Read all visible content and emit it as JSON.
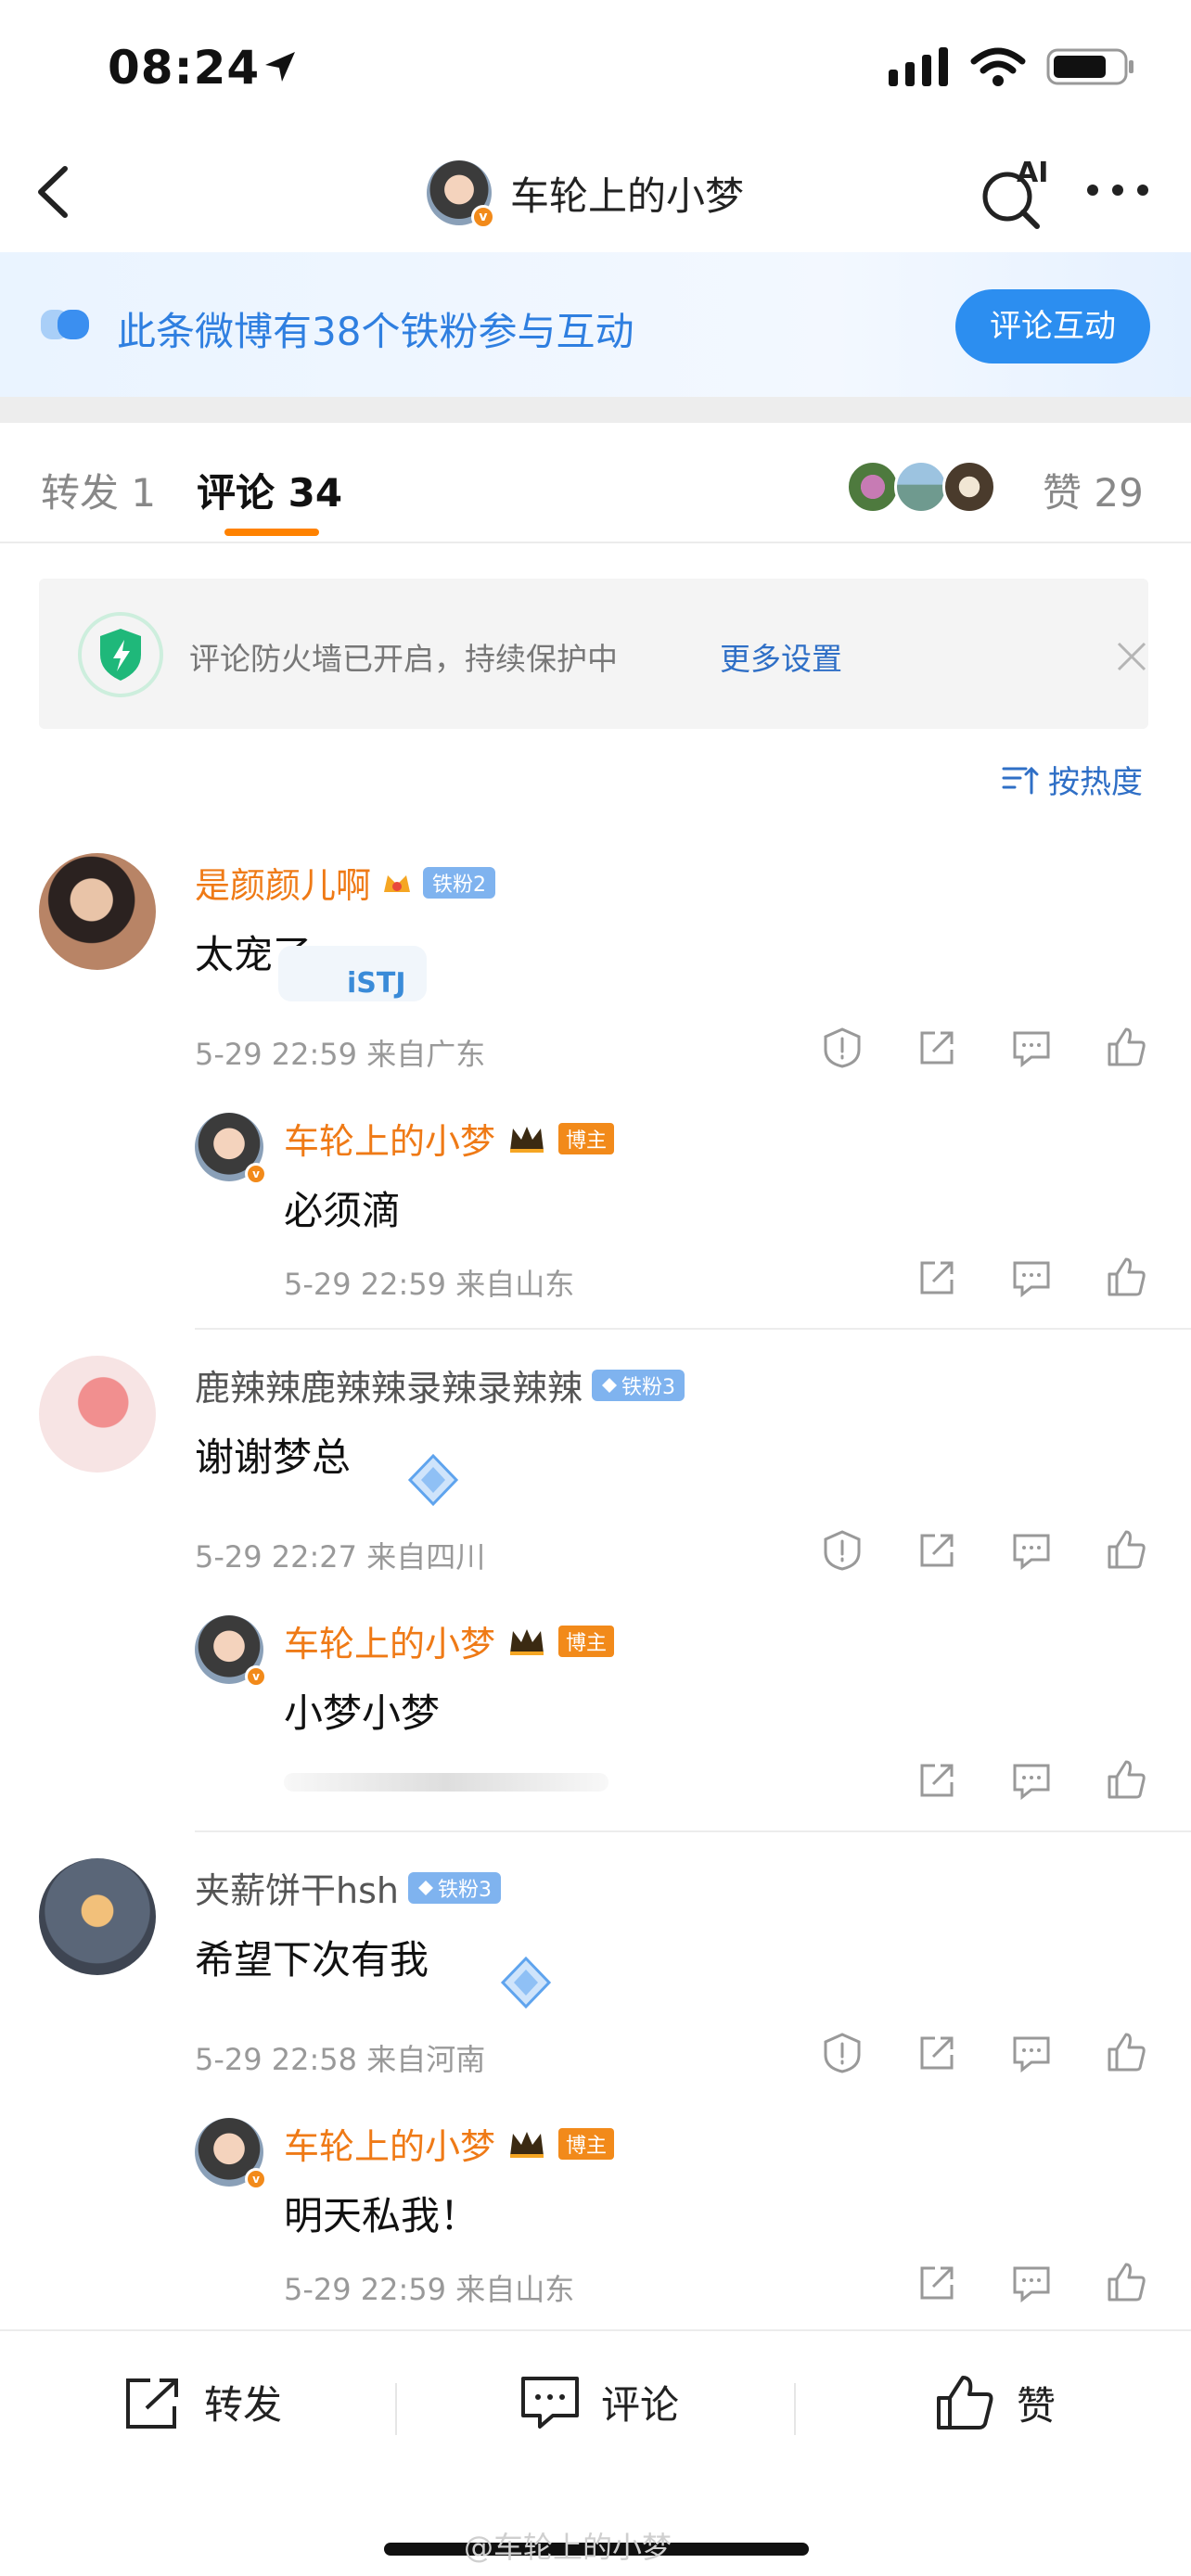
{
  "status_bar": {
    "time": "08:24"
  },
  "nav": {
    "title": "车轮上的小梦",
    "ai_label": "AI"
  },
  "banner": {
    "text": "此条微博有38个铁粉参与互动",
    "button": "评论互动"
  },
  "tabs": {
    "forward": "转发 1",
    "comment": "评论 34",
    "like": "赞 29"
  },
  "notice": {
    "text": "评论防火墙已开启，持续保护中",
    "link": "更多设置"
  },
  "sort": {
    "label": "按热度"
  },
  "comments": [
    {
      "name": "是颜颜儿啊",
      "badge": "铁粉2",
      "text": "太宠了",
      "meta": "5-29 22:59  来自广东",
      "reply": {
        "name": "车轮上的小梦",
        "badge": "博主",
        "text": "必须滴",
        "meta": "5-29 22:59  来自山东"
      }
    },
    {
      "name": "鹿辣辣鹿辣辣录辣录辣辣",
      "badge": "铁粉3",
      "text": "谢谢梦总",
      "meta": "5-29 22:27  来自四川",
      "reply": {
        "name": "车轮上的小梦",
        "badge": "博主",
        "text": "小梦小梦",
        "meta": ""
      }
    },
    {
      "name": "夹薪饼干hsh",
      "badge": "铁粉3",
      "text": "希望下次有我",
      "meta": "5-29 22:58  来自河南",
      "reply": {
        "name": "车轮上的小梦",
        "badge": "博主",
        "text": "明天私我！",
        "meta": "5-29 22:59  来自山东"
      }
    }
  ],
  "bottom_bar": {
    "forward": "转发",
    "comment": "评论",
    "like": "赞"
  },
  "watermark": "@车轮上的小梦",
  "colors": {
    "accent": "#ff8200",
    "link": "#2f6fc6",
    "banner_button": "#2c8ef0",
    "name_orange": "#ef7a16"
  }
}
